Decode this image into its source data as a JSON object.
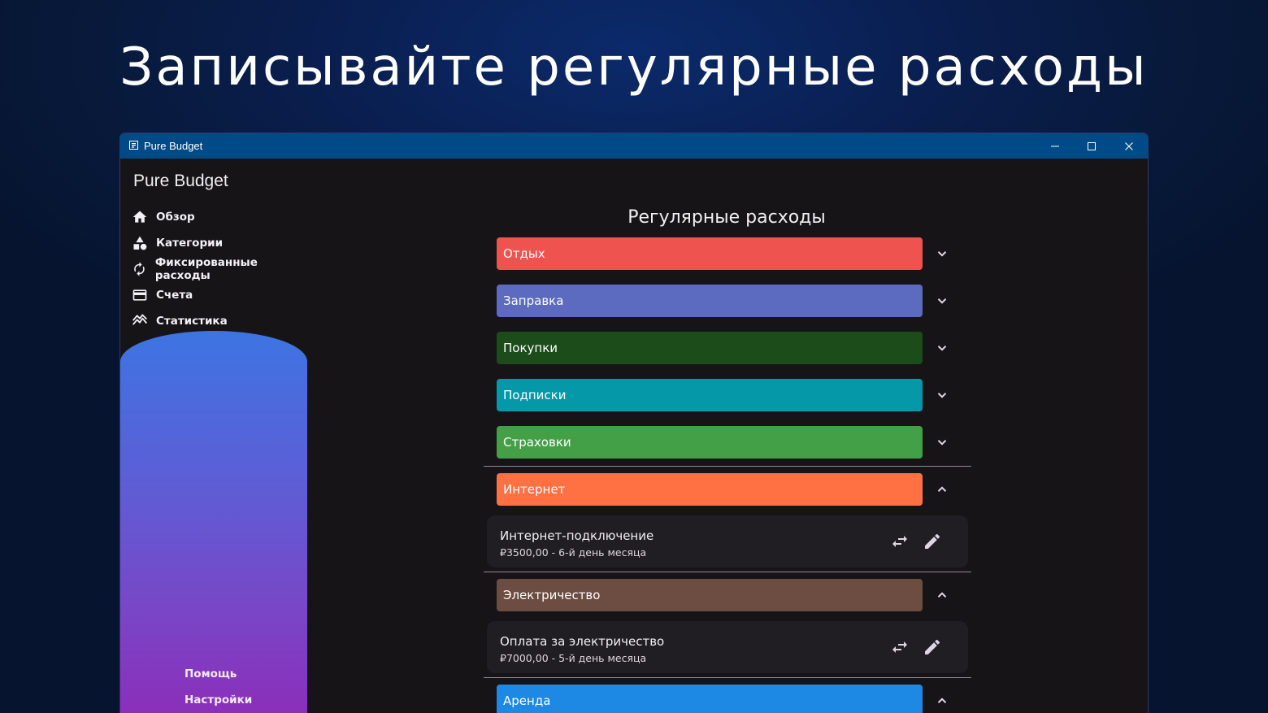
{
  "headline": "Записывайте регулярные расходы",
  "window": {
    "title": "Pure Budget",
    "controls": {
      "minimize_icon": "minimize-icon",
      "maximize_icon": "maximize-icon",
      "close_icon": "close-icon"
    }
  },
  "sidebar": {
    "app_name": "Pure Budget",
    "items": [
      {
        "label": "Обзор",
        "icon": "home-icon"
      },
      {
        "label": "Категории",
        "icon": "shapes-icon"
      },
      {
        "label": "Фиксированные расходы",
        "icon": "refresh-icon"
      },
      {
        "label": "Счета",
        "icon": "wallet-icon"
      },
      {
        "label": "Статистика",
        "icon": "chart-icon"
      }
    ],
    "footer": [
      {
        "label": "Помощь"
      },
      {
        "label": "Настройки"
      }
    ]
  },
  "main": {
    "title": "Регулярные расходы",
    "categories": [
      {
        "name": "Отдых",
        "color": "#ee5350",
        "expanded": false
      },
      {
        "name": "Заправка",
        "color": "#5c6bc0",
        "expanded": false
      },
      {
        "name": "Покупки",
        "color": "#1b4c1a",
        "expanded": false
      },
      {
        "name": "Подписки",
        "color": "#0598a8",
        "expanded": false
      },
      {
        "name": "Страховки",
        "color": "#43a047",
        "expanded": false
      },
      {
        "name": "Интернет",
        "color": "#ff7043",
        "expanded": true,
        "items": [
          {
            "name": "Интернет-подключение",
            "detail": "₽3500,00 - 6-й день месяца"
          }
        ]
      },
      {
        "name": "Электричество",
        "color": "#6d4c41",
        "expanded": true,
        "items": [
          {
            "name": "Оплата за электричество",
            "detail": "₽7000,00 - 5-й день месяца"
          }
        ]
      },
      {
        "name": "Аренда",
        "color": "#1e88e5",
        "expanded": true
      }
    ]
  }
}
